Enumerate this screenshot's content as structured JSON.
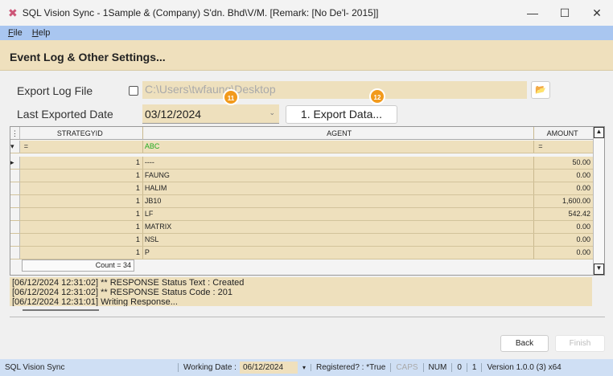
{
  "window": {
    "title": "SQL Vision Sync - 1Sample & (Company) S'dn. Bhd\\V/M. [Remark: [No De'l- 2015]]",
    "minimize": "—",
    "maximize": "☐",
    "close": "✕"
  },
  "menu": [
    "File",
    "Help"
  ],
  "header": {
    "title": "Event Log & Other Settings..."
  },
  "form": {
    "export_log_label": "Export Log File",
    "export_log_checked": false,
    "export_path": "C:\\Users\\twfaung\\Desktop",
    "last_exported_label": "Last Exported Date",
    "last_exported_value": "03/12/2024",
    "export_button": "1. Export Data..."
  },
  "markers": [
    "11",
    "12"
  ],
  "grid": {
    "columns": [
      "STRATEGYID",
      "AGENT",
      "AMOUNT"
    ],
    "filter": [
      "=",
      "ABC",
      "="
    ],
    "rows": [
      [
        "1",
        "----",
        "50.00"
      ],
      [
        "1",
        "FAUNG",
        "0.00"
      ],
      [
        "1",
        "HALIM",
        "0.00"
      ],
      [
        "1",
        "JB10",
        "1,600.00"
      ],
      [
        "1",
        "LF",
        "542.42"
      ],
      [
        "1",
        "MATRIX",
        "0.00"
      ],
      [
        "1",
        "NSL",
        "0.00"
      ],
      [
        "1",
        "P",
        "0.00"
      ]
    ],
    "footer": "Count = 34"
  },
  "log": [
    "[06/12/2024 12:31:02] ** RESPONSE Status Text : Created",
    "[06/12/2024 12:31:02] ** RESPONSE Status Code : 201",
    "[06/12/2024 12:31:01] Writing Response..."
  ],
  "buttons": {
    "back": "Back",
    "finish": "Finish"
  },
  "status": {
    "app": "SQL Vision Sync",
    "working_date_label": "Working Date :",
    "working_date": "06/12/2024",
    "registered": "Registered? : *True",
    "caps": "CAPS",
    "num": "NUM",
    "v0": "0",
    "v1": "1",
    "version": "Version 1.0.0 (3) x64"
  }
}
